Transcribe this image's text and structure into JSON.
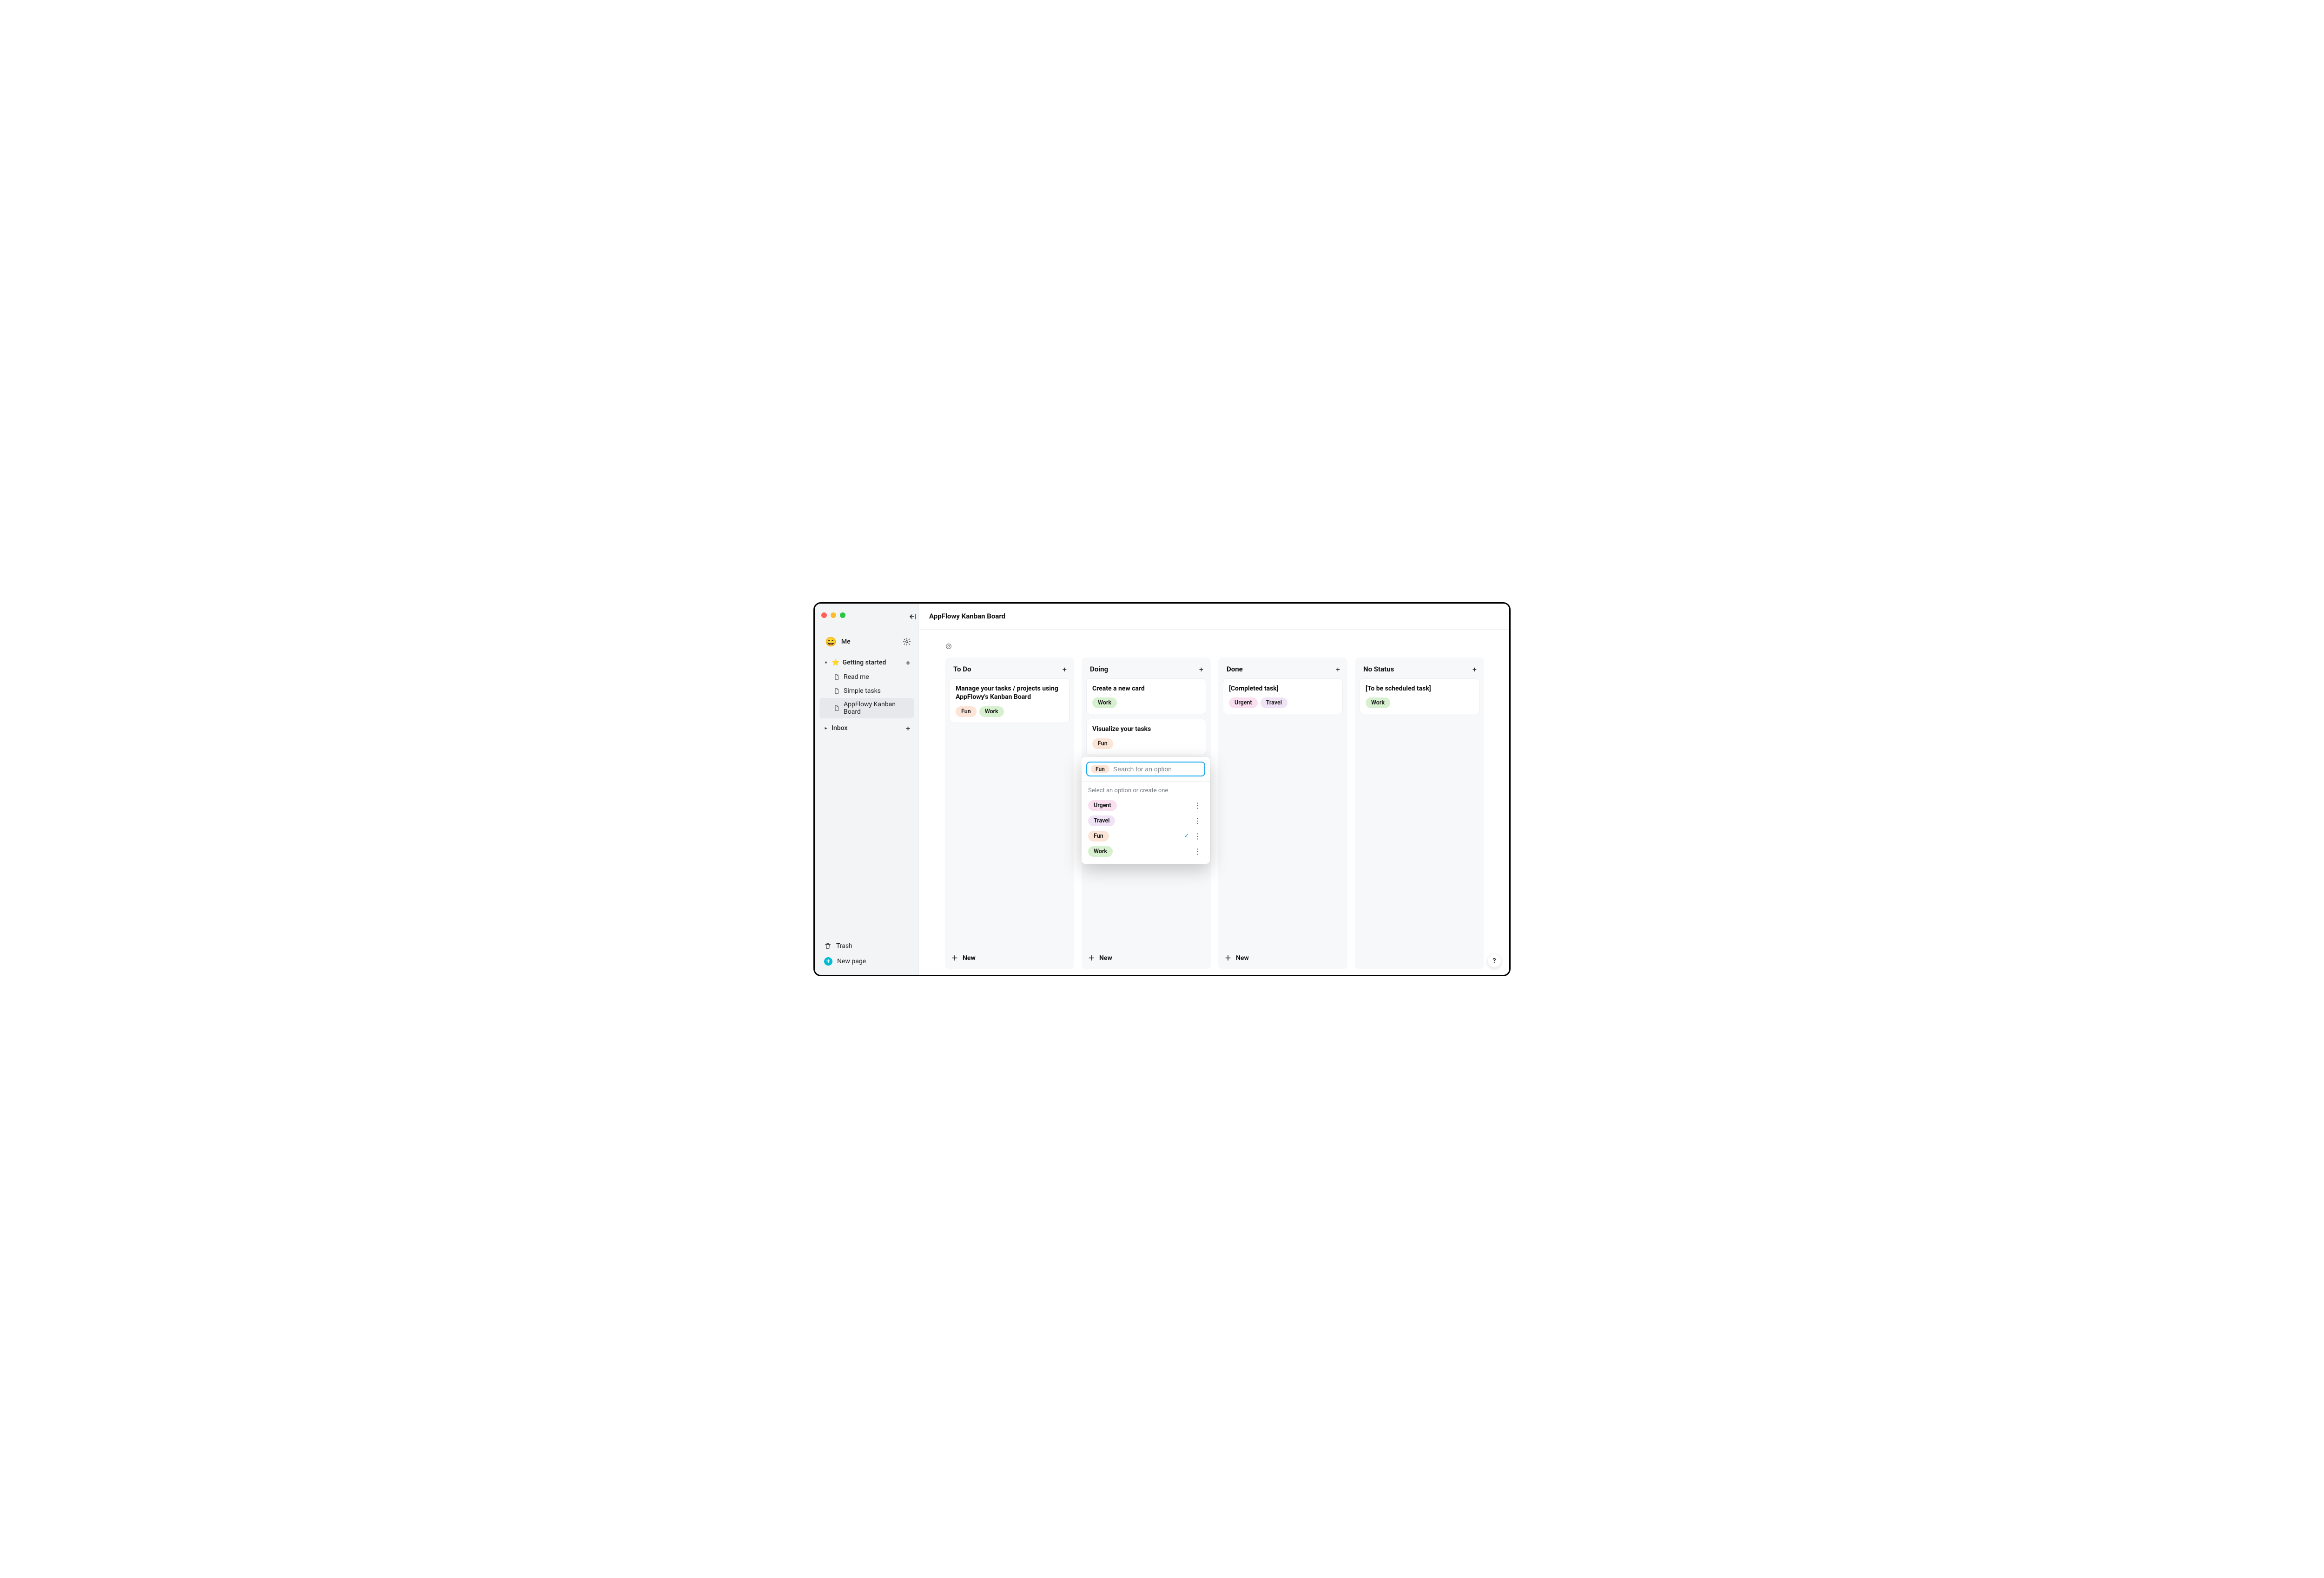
{
  "window": {
    "title": "AppFlowy Kanban Board"
  },
  "sidebar": {
    "user_name": "Me",
    "user_emoji": "😄",
    "sections": {
      "getting_started": {
        "label": "Getting started",
        "pages": {
          "read_me": "Read me",
          "simple_tasks": "Simple tasks",
          "kanban": "AppFlowy Kanban Board"
        }
      },
      "inbox": {
        "label": "Inbox"
      }
    },
    "trash": "Trash",
    "new_page": "New page"
  },
  "board": {
    "columns": [
      {
        "key": "todo",
        "title": "To Do",
        "new_label": "New",
        "cards": [
          {
            "title": "Manage your tasks / projects using AppFlowy's Kanban Board",
            "tags": [
              {
                "label": "Fun",
                "color": "peach"
              },
              {
                "label": "Work",
                "color": "green"
              }
            ]
          }
        ]
      },
      {
        "key": "doing",
        "title": "Doing",
        "new_label": "New",
        "cards": [
          {
            "title": "Create a new card",
            "tags": [
              {
                "label": "Work",
                "color": "green"
              }
            ]
          },
          {
            "title": "Visualize your tasks",
            "tags": [
              {
                "label": "Fun",
                "color": "peach"
              }
            ]
          }
        ]
      },
      {
        "key": "done",
        "title": "Done",
        "new_label": "New",
        "cards": [
          {
            "title": "[Completed task]",
            "tags": [
              {
                "label": "Urgent",
                "color": "pink"
              },
              {
                "label": "Travel",
                "color": "lilac"
              }
            ]
          }
        ]
      },
      {
        "key": "nostatus",
        "title": "No Status",
        "new_label": "",
        "cards": [
          {
            "title": "[To be scheduled task]",
            "tags": [
              {
                "label": "Work",
                "color": "green"
              }
            ]
          }
        ]
      }
    ]
  },
  "tag_popover": {
    "selected": [
      {
        "label": "Fun",
        "color": "peach"
      }
    ],
    "placeholder": "Search for an option",
    "hint": "Select an option or create one",
    "options": [
      {
        "label": "Urgent",
        "color": "pink",
        "checked": false
      },
      {
        "label": "Travel",
        "color": "lilac",
        "checked": false
      },
      {
        "label": "Fun",
        "color": "peach",
        "checked": true
      },
      {
        "label": "Work",
        "color": "green",
        "checked": false
      }
    ]
  },
  "help_label": "?"
}
